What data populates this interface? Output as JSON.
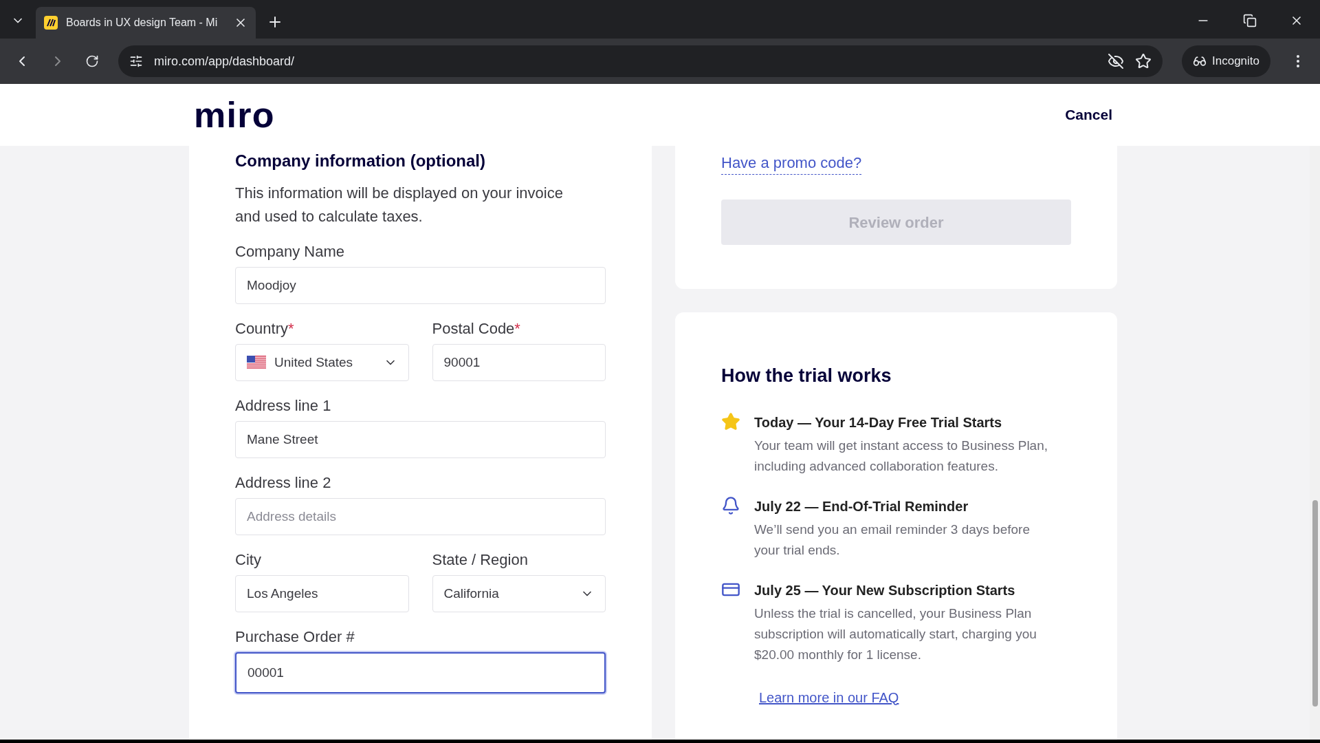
{
  "browser": {
    "tab_title": "Boards in UX design Team - Mi",
    "url": "miro.com/app/dashboard/",
    "incognito_label": "Incognito"
  },
  "header": {
    "logo": "miro",
    "cancel": "Cancel"
  },
  "form": {
    "required_mark": "*",
    "heading": "Company information (optional)",
    "description": "This information will be displayed on your invoice and used to calculate taxes.",
    "rows": [
      {
        "fields": [
          {
            "kind": "text",
            "label": "Company Name",
            "required": false,
            "value": "Moodjoy",
            "focused": false
          }
        ]
      },
      {
        "fields": [
          {
            "kind": "country",
            "label": "Country",
            "required": true,
            "value": "United States",
            "focused": false
          },
          {
            "kind": "text",
            "label": "Postal Code",
            "required": true,
            "value": "90001",
            "focused": false
          }
        ]
      },
      {
        "fields": [
          {
            "kind": "text",
            "label": "Address line 1",
            "required": false,
            "value": "Mane Street",
            "focused": false
          }
        ]
      },
      {
        "fields": [
          {
            "kind": "text",
            "label": "Address line 2",
            "required": false,
            "placeholder": "Address details",
            "focused": false
          }
        ]
      },
      {
        "fields": [
          {
            "kind": "text",
            "label": "City",
            "required": false,
            "value": "Los Angeles",
            "focused": false
          },
          {
            "kind": "select",
            "label": "State / Region",
            "required": false,
            "value": "California",
            "focused": false
          }
        ]
      },
      {
        "fields": [
          {
            "kind": "text",
            "label": "Purchase Order #",
            "required": false,
            "value": "00001",
            "focused": true
          }
        ]
      }
    ]
  },
  "order": {
    "promo_link": "Have a promo code?",
    "review_button": {
      "label": "Review order",
      "disabled": true
    }
  },
  "trial": {
    "title": "How the trial works",
    "steps": [
      {
        "kind": "star",
        "title": "Today — Your 14-Day Free Trial Starts",
        "text": "Your team will get instant access to Business Plan, including advanced collaboration features."
      },
      {
        "kind": "bell",
        "title": "July 22 — End-Of-Trial Reminder",
        "text": "We’ll send you an email reminder 3 days before your trial ends."
      },
      {
        "kind": "card",
        "title": "July 25 — Your New Subscription Starts",
        "text": "Unless the trial is cancelled, your Business Plan subscription will automatically start, charging you $20.00 monthly for 1 license."
      }
    ],
    "faq_link": "Learn more in our FAQ"
  }
}
